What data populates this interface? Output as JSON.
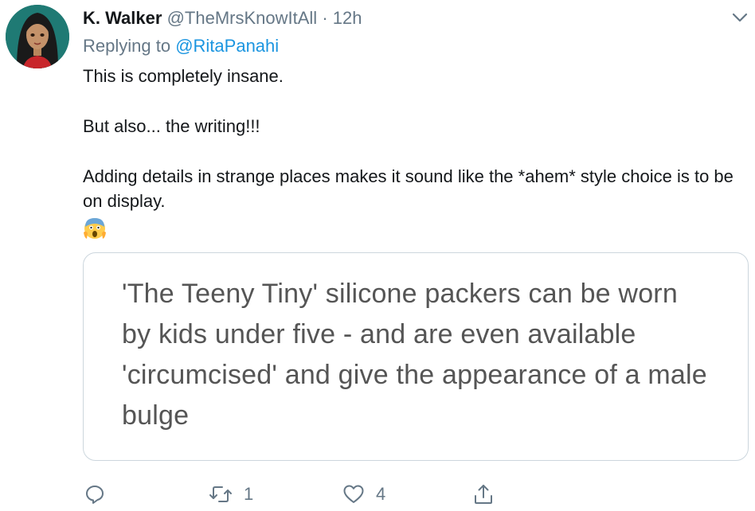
{
  "tweet": {
    "author_name": "K. Walker",
    "author_handle": "@TheMrsKnowItAll",
    "separator": "·",
    "time": "12h",
    "replying_prefix": "Replying to",
    "replying_to": "@RitaPanahi",
    "lines": {
      "line1": "This is completely insane.",
      "line2": "But also... the writing!!!",
      "line3": "Adding details in strange places makes it sound like the *ahem* style choice is to be on display."
    },
    "emoji_icon": "face-screaming-in-fear-icon",
    "quoted_card": {
      "text": "'The Teeny Tiny' silicone packers can be worn by kids under five - and are even available 'circumcised' and give the appearance of a male bulge"
    },
    "actions": {
      "reply_icon": "reply-icon",
      "retweet_icon": "retweet-icon",
      "retweet_count": "1",
      "like_icon": "heart-icon",
      "like_count": "4",
      "share_icon": "share-icon"
    },
    "caret_icon": "chevron-down-icon"
  },
  "colors": {
    "text_primary": "#14171a",
    "text_secondary": "#657786",
    "link": "#1b95e0",
    "card_border": "#ccd6dd",
    "card_text": "#555555"
  }
}
